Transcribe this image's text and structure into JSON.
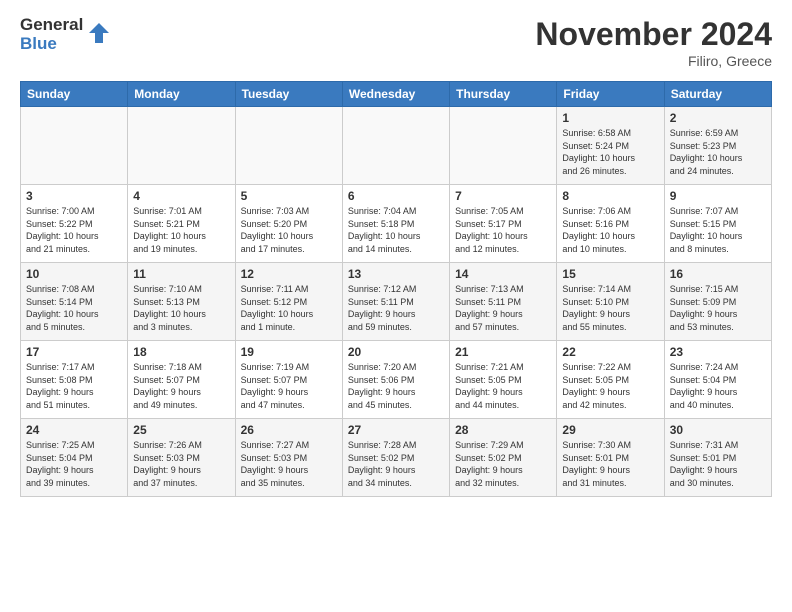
{
  "logo": {
    "line1": "General",
    "line2": "Blue"
  },
  "title": "November 2024",
  "location": "Filiro, Greece",
  "days_header": [
    "Sunday",
    "Monday",
    "Tuesday",
    "Wednesday",
    "Thursday",
    "Friday",
    "Saturday"
  ],
  "weeks": [
    [
      {
        "day": "",
        "info": ""
      },
      {
        "day": "",
        "info": ""
      },
      {
        "day": "",
        "info": ""
      },
      {
        "day": "",
        "info": ""
      },
      {
        "day": "",
        "info": ""
      },
      {
        "day": "1",
        "info": "Sunrise: 6:58 AM\nSunset: 5:24 PM\nDaylight: 10 hours\nand 26 minutes."
      },
      {
        "day": "2",
        "info": "Sunrise: 6:59 AM\nSunset: 5:23 PM\nDaylight: 10 hours\nand 24 minutes."
      }
    ],
    [
      {
        "day": "3",
        "info": "Sunrise: 7:00 AM\nSunset: 5:22 PM\nDaylight: 10 hours\nand 21 minutes."
      },
      {
        "day": "4",
        "info": "Sunrise: 7:01 AM\nSunset: 5:21 PM\nDaylight: 10 hours\nand 19 minutes."
      },
      {
        "day": "5",
        "info": "Sunrise: 7:03 AM\nSunset: 5:20 PM\nDaylight: 10 hours\nand 17 minutes."
      },
      {
        "day": "6",
        "info": "Sunrise: 7:04 AM\nSunset: 5:18 PM\nDaylight: 10 hours\nand 14 minutes."
      },
      {
        "day": "7",
        "info": "Sunrise: 7:05 AM\nSunset: 5:17 PM\nDaylight: 10 hours\nand 12 minutes."
      },
      {
        "day": "8",
        "info": "Sunrise: 7:06 AM\nSunset: 5:16 PM\nDaylight: 10 hours\nand 10 minutes."
      },
      {
        "day": "9",
        "info": "Sunrise: 7:07 AM\nSunset: 5:15 PM\nDaylight: 10 hours\nand 8 minutes."
      }
    ],
    [
      {
        "day": "10",
        "info": "Sunrise: 7:08 AM\nSunset: 5:14 PM\nDaylight: 10 hours\nand 5 minutes."
      },
      {
        "day": "11",
        "info": "Sunrise: 7:10 AM\nSunset: 5:13 PM\nDaylight: 10 hours\nand 3 minutes."
      },
      {
        "day": "12",
        "info": "Sunrise: 7:11 AM\nSunset: 5:12 PM\nDaylight: 10 hours\nand 1 minute."
      },
      {
        "day": "13",
        "info": "Sunrise: 7:12 AM\nSunset: 5:11 PM\nDaylight: 9 hours\nand 59 minutes."
      },
      {
        "day": "14",
        "info": "Sunrise: 7:13 AM\nSunset: 5:11 PM\nDaylight: 9 hours\nand 57 minutes."
      },
      {
        "day": "15",
        "info": "Sunrise: 7:14 AM\nSunset: 5:10 PM\nDaylight: 9 hours\nand 55 minutes."
      },
      {
        "day": "16",
        "info": "Sunrise: 7:15 AM\nSunset: 5:09 PM\nDaylight: 9 hours\nand 53 minutes."
      }
    ],
    [
      {
        "day": "17",
        "info": "Sunrise: 7:17 AM\nSunset: 5:08 PM\nDaylight: 9 hours\nand 51 minutes."
      },
      {
        "day": "18",
        "info": "Sunrise: 7:18 AM\nSunset: 5:07 PM\nDaylight: 9 hours\nand 49 minutes."
      },
      {
        "day": "19",
        "info": "Sunrise: 7:19 AM\nSunset: 5:07 PM\nDaylight: 9 hours\nand 47 minutes."
      },
      {
        "day": "20",
        "info": "Sunrise: 7:20 AM\nSunset: 5:06 PM\nDaylight: 9 hours\nand 45 minutes."
      },
      {
        "day": "21",
        "info": "Sunrise: 7:21 AM\nSunset: 5:05 PM\nDaylight: 9 hours\nand 44 minutes."
      },
      {
        "day": "22",
        "info": "Sunrise: 7:22 AM\nSunset: 5:05 PM\nDaylight: 9 hours\nand 42 minutes."
      },
      {
        "day": "23",
        "info": "Sunrise: 7:24 AM\nSunset: 5:04 PM\nDaylight: 9 hours\nand 40 minutes."
      }
    ],
    [
      {
        "day": "24",
        "info": "Sunrise: 7:25 AM\nSunset: 5:04 PM\nDaylight: 9 hours\nand 39 minutes."
      },
      {
        "day": "25",
        "info": "Sunrise: 7:26 AM\nSunset: 5:03 PM\nDaylight: 9 hours\nand 37 minutes."
      },
      {
        "day": "26",
        "info": "Sunrise: 7:27 AM\nSunset: 5:03 PM\nDaylight: 9 hours\nand 35 minutes."
      },
      {
        "day": "27",
        "info": "Sunrise: 7:28 AM\nSunset: 5:02 PM\nDaylight: 9 hours\nand 34 minutes."
      },
      {
        "day": "28",
        "info": "Sunrise: 7:29 AM\nSunset: 5:02 PM\nDaylight: 9 hours\nand 32 minutes."
      },
      {
        "day": "29",
        "info": "Sunrise: 7:30 AM\nSunset: 5:01 PM\nDaylight: 9 hours\nand 31 minutes."
      },
      {
        "day": "30",
        "info": "Sunrise: 7:31 AM\nSunset: 5:01 PM\nDaylight: 9 hours\nand 30 minutes."
      }
    ]
  ]
}
